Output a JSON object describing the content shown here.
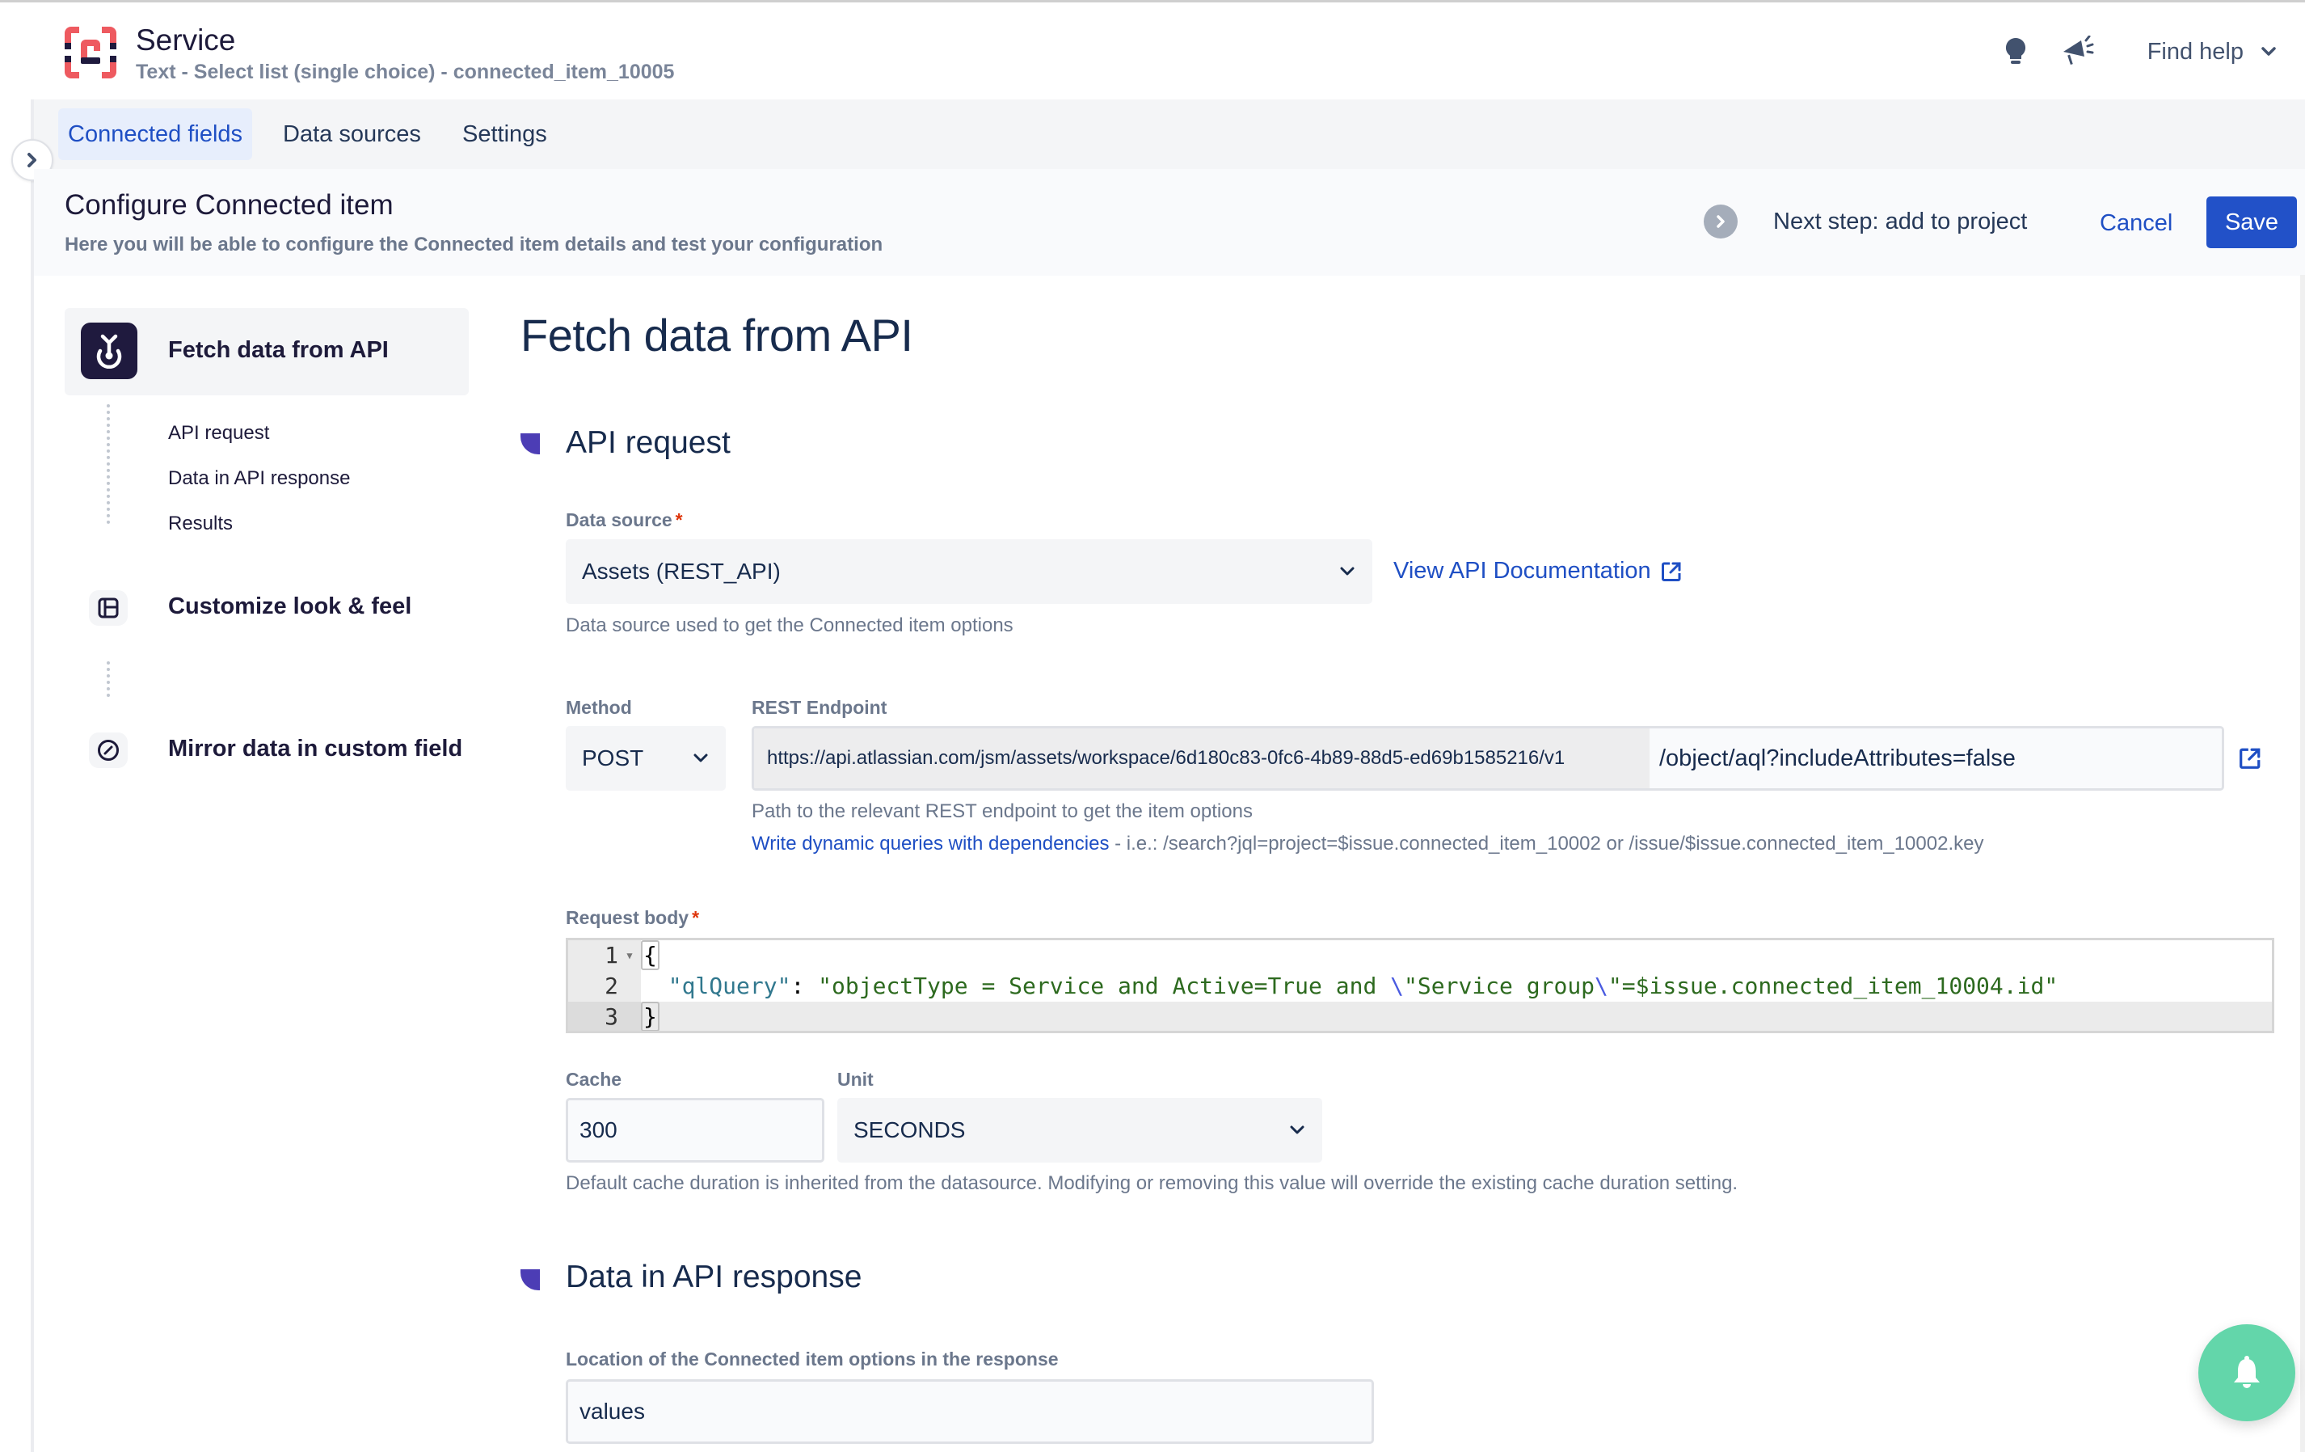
{
  "header": {
    "app_title": "Service",
    "app_subtitle": "Text - Select list (single choice) - connected_item_10005",
    "find_help_label": "Find help",
    "icons": [
      "lightbulb-icon",
      "megaphone-icon",
      "chevron-down-icon"
    ]
  },
  "tabs": [
    {
      "label": "Connected fields",
      "active": true
    },
    {
      "label": "Data sources",
      "active": false
    },
    {
      "label": "Settings",
      "active": false
    }
  ],
  "config": {
    "title": "Configure Connected item",
    "description": "Here you will be able to configure the Connected item details and test your configuration",
    "next_step_label": "Next step: add to project",
    "cancel_label": "Cancel",
    "save_label": "Save"
  },
  "steps": {
    "active": {
      "label": "Fetch data from API",
      "icon": "api-fetch-icon"
    },
    "substeps": [
      "API request",
      "Data in API response",
      "Results"
    ],
    "others": [
      {
        "label": "Customize look & feel",
        "icon": "layout-icon"
      },
      {
        "label": "Mirror data in custom field",
        "icon": "gauge-icon"
      }
    ]
  },
  "main": {
    "title": "Fetch data from API",
    "api_request": {
      "section_title": "API request",
      "data_source": {
        "label": "Data source",
        "required": "*",
        "value": "Assets (REST_API)",
        "helper": "Data source used to get the Connected item options",
        "doc_link": "View API Documentation"
      },
      "method": {
        "label": "Method",
        "value": "POST"
      },
      "endpoint": {
        "label": "REST Endpoint",
        "base_url": "https://api.atlassian.com/jsm/assets/workspace/6d180c83-0fc6-4b89-88d5-ed69b1585216/v1",
        "path": "/object/aql?includeAttributes=false",
        "helper": "Path to the relevant REST endpoint to get the item options",
        "dynamic_link": "Write dynamic queries with dependencies",
        "dynamic_example": " - i.e.: /search?jql=project=$issue.connected_item_10002 or /issue/$issue.connected_item_10002.key"
      },
      "request_body": {
        "label": "Request body",
        "required": "*",
        "line_numbers": [
          "1",
          "2",
          "3"
        ],
        "lines": {
          "open_brace": "{",
          "indent": "  ",
          "key": "\"qlQuery\"",
          "colon": ": ",
          "str_part1": "\"objectType = Service and Active=True and ",
          "esc1": "\\",
          "str_part2": "\"Service group",
          "esc2": "\\",
          "str_part3": "\"=$issue.connected_item_10004.id\"",
          "close_brace": "}"
        }
      },
      "cache": {
        "label": "Cache",
        "value": "300"
      },
      "unit": {
        "label": "Unit",
        "value": "SECONDS"
      },
      "cache_helper": "Default cache duration is inherited from the datasource. Modifying or removing this value will override the existing cache duration setting."
    },
    "data_in_response": {
      "section_title": "Data in API response",
      "location": {
        "label": "Location of the Connected item options in the response",
        "value": "values"
      }
    }
  },
  "colors": {
    "primary": "#2251c8",
    "link": "#1f4fc4",
    "brand_red": "#ee5a60",
    "brand_dark": "#1f1a3e",
    "section_accent": "#4c3db5",
    "fab": "#63d6aa",
    "required": "#de350b"
  }
}
